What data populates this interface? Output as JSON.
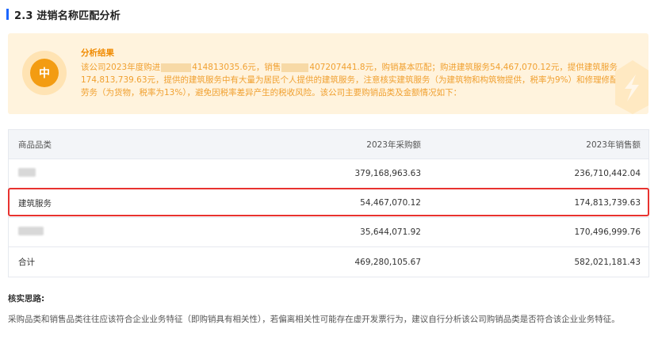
{
  "section": {
    "title": "2.3 进销名称匹配分析"
  },
  "result": {
    "grade": "中",
    "heading": "分析结果",
    "text_part1": "该公司2023年度购进",
    "purchase_amount": "414813035.6元，销售",
    "sales_amount": "407207441.8元，购销基本匹配；购进建筑服务54,467,070.12元，提供建筑服务174,813,739.63元，提供的建筑服务中有大量为居民个人提供的建筑服务，注意核实建筑服务（为建筑物和构筑物提供，税率为9%）和修理修配劳务（为货物，税率为13%），避免因税率差异产生的税收风险。该公司主要购销品类及金额情况如下："
  },
  "table": {
    "headers": [
      "商品品类",
      "2023年采购额",
      "2023年销售额"
    ],
    "rows": [
      {
        "category": "",
        "purchase": "379,168,963.63",
        "sales": "236,710,442.04"
      },
      {
        "category": "建筑服务",
        "purchase": "54,467,070.12",
        "sales": "174,813,739.63"
      },
      {
        "category": "",
        "purchase": "35,644,071.92",
        "sales": "170,496,999.76"
      },
      {
        "category": "合计",
        "purchase": "469,280,105.67",
        "sales": "582,021,181.43"
      }
    ]
  },
  "idea": {
    "title": "核实思路:",
    "text": "采购品类和销售品类往往应该符合企业业务特征（即购销具有相关性），若偏离相关性可能存在虚开发票行为，建议自行分析该公司购销品类是否符合该企业业务特征。"
  },
  "colors": {
    "accent": "#1a66ff",
    "warning": "#f39c12",
    "highlight": "#e8322f"
  }
}
